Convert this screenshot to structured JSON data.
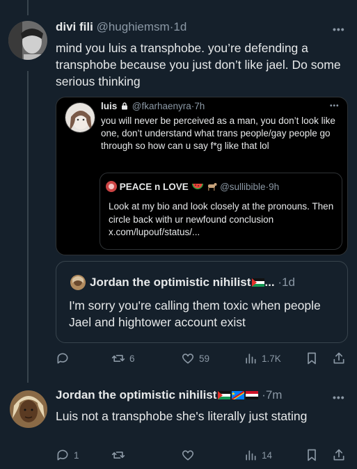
{
  "tweet1": {
    "display_name": "divi fili",
    "handle": "@hughiemsm",
    "time": "1d",
    "text": "mind you luis a transphobe. you’re defending a transphobe because you just don’t like jael. Do some serious thinking",
    "quote": {
      "display_name": "luis",
      "handle": "@fkarhaenyra",
      "time": "7h",
      "text": "you will never be perceived as a man, you don’t look like one, don’t understand what trans people/gay people go through so how can u say f*g like that lol",
      "nested_quote": {
        "display_name": "PEACE n LOVE",
        "handle": "@sullibible",
        "time": "9h",
        "text": "Look at my bio and look closely at the pronouns. Then circle back with ur newfound conclusion x.com/lupouf/status/..."
      }
    }
  },
  "quote_card": {
    "display_name": "Jordan the optimistic nihilist",
    "truncation": "...",
    "time": "1d",
    "text": "I'm sorry you're calling them toxic when people Jael and hightower account exist"
  },
  "actions1": {
    "replies": "",
    "reposts": "6",
    "likes": "59",
    "views": "1.7K"
  },
  "tweet2": {
    "display_name": "Jordan the optimistic nihilist",
    "time": "7m",
    "text": "Luis not a transphobe she's literally just stating"
  },
  "actions2": {
    "replies": "1",
    "reposts": "",
    "likes": "",
    "views": "14"
  },
  "separator": "·",
  "more_glyph": "•••",
  "icons": [
    "reply-icon",
    "repost-icon",
    "like-icon",
    "views-icon",
    "bookmark-icon",
    "share-icon",
    "more-icon",
    "lock-icon"
  ],
  "colors": {
    "background": "#15202b",
    "quote_bg": "#000000",
    "text": "#e7e9ea",
    "muted": "#8b98a5",
    "border": "#38444d"
  }
}
